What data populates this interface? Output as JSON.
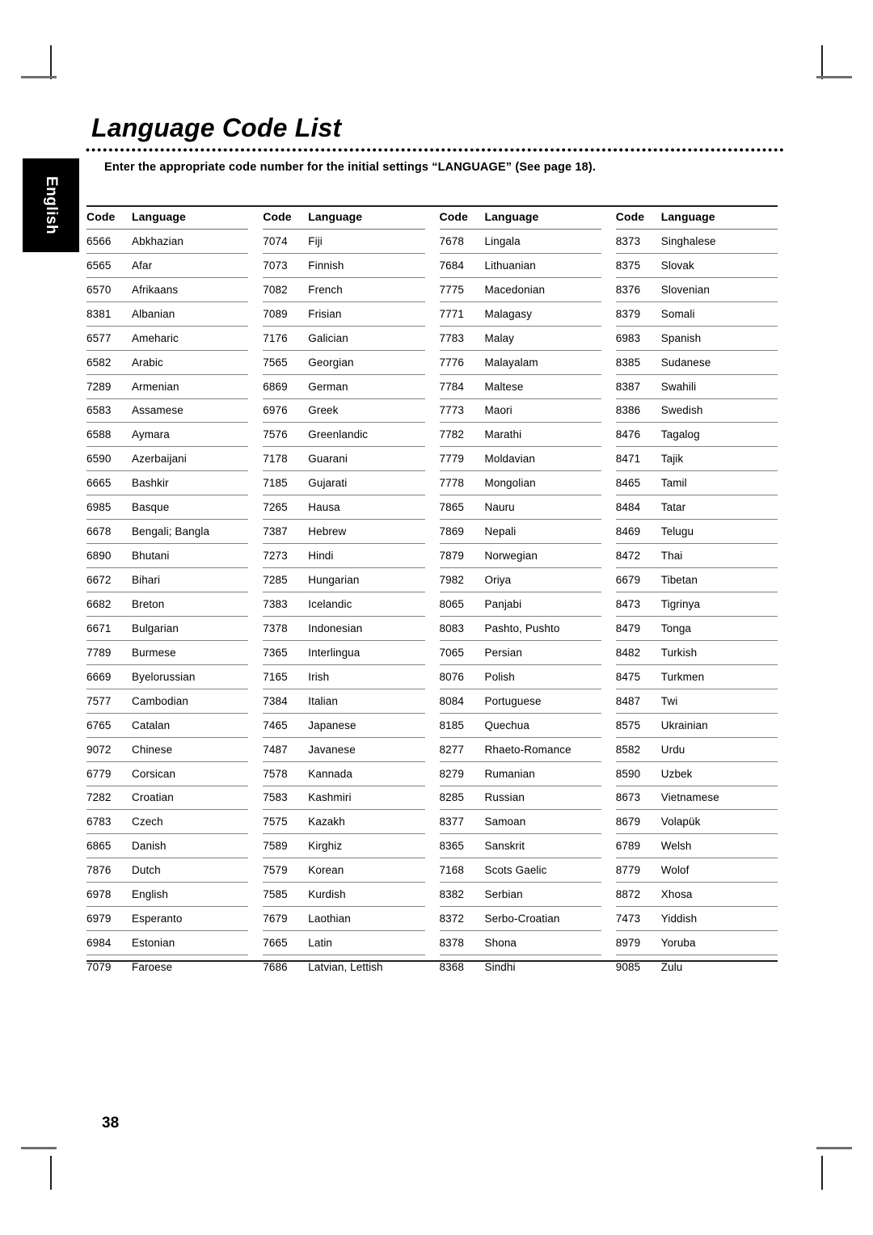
{
  "page": {
    "title": "Language Code List",
    "subtitle": "Enter the appropriate code number for the initial settings “LANGUAGE” (See page 18).",
    "side_tab_label": "English",
    "page_number": "38"
  },
  "table": {
    "headers": {
      "code": "Code",
      "language": "Language"
    },
    "columns": [
      {
        "rows": [
          {
            "code": "6566",
            "language": "Abkhazian"
          },
          {
            "code": "6565",
            "language": "Afar"
          },
          {
            "code": "6570",
            "language": "Afrikaans"
          },
          {
            "code": "8381",
            "language": "Albanian"
          },
          {
            "code": "6577",
            "language": "Ameharic"
          },
          {
            "code": "6582",
            "language": "Arabic"
          },
          {
            "code": "7289",
            "language": "Armenian"
          },
          {
            "code": "6583",
            "language": "Assamese"
          },
          {
            "code": "6588",
            "language": "Aymara"
          },
          {
            "code": "6590",
            "language": "Azerbaijani"
          },
          {
            "code": "6665",
            "language": "Bashkir"
          },
          {
            "code": "6985",
            "language": "Basque"
          },
          {
            "code": "6678",
            "language": "Bengali; Bangla"
          },
          {
            "code": "6890",
            "language": "Bhutani"
          },
          {
            "code": "6672",
            "language": "Bihari"
          },
          {
            "code": "6682",
            "language": "Breton"
          },
          {
            "code": "6671",
            "language": "Bulgarian"
          },
          {
            "code": "7789",
            "language": "Burmese"
          },
          {
            "code": "6669",
            "language": "Byelorussian"
          },
          {
            "code": "7577",
            "language": "Cambodian"
          },
          {
            "code": "6765",
            "language": "Catalan"
          },
          {
            "code": "9072",
            "language": "Chinese"
          },
          {
            "code": "6779",
            "language": "Corsican"
          },
          {
            "code": "7282",
            "language": "Croatian"
          },
          {
            "code": "6783",
            "language": "Czech"
          },
          {
            "code": "6865",
            "language": "Danish"
          },
          {
            "code": "7876",
            "language": "Dutch"
          },
          {
            "code": "6978",
            "language": "English"
          },
          {
            "code": "6979",
            "language": "Esperanto"
          },
          {
            "code": "6984",
            "language": "Estonian"
          },
          {
            "code": "7079",
            "language": "Faroese"
          }
        ]
      },
      {
        "rows": [
          {
            "code": "7074",
            "language": "Fiji"
          },
          {
            "code": "7073",
            "language": "Finnish"
          },
          {
            "code": "7082",
            "language": "French"
          },
          {
            "code": "7089",
            "language": "Frisian"
          },
          {
            "code": "7176",
            "language": "Galician"
          },
          {
            "code": "7565",
            "language": "Georgian"
          },
          {
            "code": "6869",
            "language": "German"
          },
          {
            "code": "6976",
            "language": "Greek"
          },
          {
            "code": "7576",
            "language": "Greenlandic"
          },
          {
            "code": "7178",
            "language": "Guarani"
          },
          {
            "code": "7185",
            "language": "Gujarati"
          },
          {
            "code": "7265",
            "language": "Hausa"
          },
          {
            "code": "7387",
            "language": "Hebrew"
          },
          {
            "code": "7273",
            "language": "Hindi"
          },
          {
            "code": "7285",
            "language": "Hungarian"
          },
          {
            "code": "7383",
            "language": "Icelandic"
          },
          {
            "code": "7378",
            "language": "Indonesian"
          },
          {
            "code": "7365",
            "language": "Interlingua"
          },
          {
            "code": "7165",
            "language": "Irish"
          },
          {
            "code": "7384",
            "language": "Italian"
          },
          {
            "code": "7465",
            "language": "Japanese"
          },
          {
            "code": "7487",
            "language": "Javanese"
          },
          {
            "code": "7578",
            "language": "Kannada"
          },
          {
            "code": "7583",
            "language": "Kashmiri"
          },
          {
            "code": "7575",
            "language": "Kazakh"
          },
          {
            "code": "7589",
            "language": "Kirghiz"
          },
          {
            "code": "7579",
            "language": "Korean"
          },
          {
            "code": "7585",
            "language": "Kurdish"
          },
          {
            "code": "7679",
            "language": "Laothian"
          },
          {
            "code": "7665",
            "language": "Latin"
          },
          {
            "code": "7686",
            "language": "Latvian, Lettish"
          }
        ]
      },
      {
        "rows": [
          {
            "code": "7678",
            "language": "Lingala"
          },
          {
            "code": "7684",
            "language": "Lithuanian"
          },
          {
            "code": "7775",
            "language": "Macedonian"
          },
          {
            "code": "7771",
            "language": "Malagasy"
          },
          {
            "code": "7783",
            "language": "Malay"
          },
          {
            "code": "7776",
            "language": "Malayalam"
          },
          {
            "code": "7784",
            "language": "Maltese"
          },
          {
            "code": "7773",
            "language": "Maori"
          },
          {
            "code": "7782",
            "language": "Marathi"
          },
          {
            "code": "7779",
            "language": "Moldavian"
          },
          {
            "code": "7778",
            "language": "Mongolian"
          },
          {
            "code": "7865",
            "language": "Nauru"
          },
          {
            "code": "7869",
            "language": "Nepali"
          },
          {
            "code": "7879",
            "language": "Norwegian"
          },
          {
            "code": "7982",
            "language": "Oriya"
          },
          {
            "code": "8065",
            "language": "Panjabi"
          },
          {
            "code": "8083",
            "language": "Pashto, Pushto"
          },
          {
            "code": "7065",
            "language": "Persian"
          },
          {
            "code": "8076",
            "language": "Polish"
          },
          {
            "code": "8084",
            "language": "Portuguese"
          },
          {
            "code": "8185",
            "language": "Quechua"
          },
          {
            "code": "8277",
            "language": "Rhaeto-Romance"
          },
          {
            "code": "8279",
            "language": "Rumanian"
          },
          {
            "code": "8285",
            "language": "Russian"
          },
          {
            "code": "8377",
            "language": "Samoan"
          },
          {
            "code": "8365",
            "language": "Sanskrit"
          },
          {
            "code": "7168",
            "language": "Scots Gaelic"
          },
          {
            "code": "8382",
            "language": "Serbian"
          },
          {
            "code": "8372",
            "language": "Serbo-Croatian"
          },
          {
            "code": "8378",
            "language": "Shona"
          },
          {
            "code": "8368",
            "language": "Sindhi"
          }
        ]
      },
      {
        "rows": [
          {
            "code": "8373",
            "language": "Singhalese"
          },
          {
            "code": "8375",
            "language": "Slovak"
          },
          {
            "code": "8376",
            "language": "Slovenian"
          },
          {
            "code": "8379",
            "language": "Somali"
          },
          {
            "code": "6983",
            "language": "Spanish"
          },
          {
            "code": "8385",
            "language": "Sudanese"
          },
          {
            "code": "8387",
            "language": "Swahili"
          },
          {
            "code": "8386",
            "language": "Swedish"
          },
          {
            "code": "8476",
            "language": "Tagalog"
          },
          {
            "code": "8471",
            "language": "Tajik"
          },
          {
            "code": "8465",
            "language": "Tamil"
          },
          {
            "code": "8484",
            "language": "Tatar"
          },
          {
            "code": "8469",
            "language": "Telugu"
          },
          {
            "code": "8472",
            "language": "Thai"
          },
          {
            "code": "6679",
            "language": "Tibetan"
          },
          {
            "code": "8473",
            "language": "Tigrinya"
          },
          {
            "code": "8479",
            "language": "Tonga"
          },
          {
            "code": "8482",
            "language": "Turkish"
          },
          {
            "code": "8475",
            "language": "Turkmen"
          },
          {
            "code": "8487",
            "language": "Twi"
          },
          {
            "code": "8575",
            "language": "Ukrainian"
          },
          {
            "code": "8582",
            "language": "Urdu"
          },
          {
            "code": "8590",
            "language": "Uzbek"
          },
          {
            "code": "8673",
            "language": "Vietnamese"
          },
          {
            "code": "8679",
            "language": "Volapük"
          },
          {
            "code": "6789",
            "language": "Welsh"
          },
          {
            "code": "8779",
            "language": "Wolof"
          },
          {
            "code": "8872",
            "language": "Xhosa"
          },
          {
            "code": "7473",
            "language": "Yiddish"
          },
          {
            "code": "8979",
            "language": "Yoruba"
          },
          {
            "code": "9085",
            "language": "Zulu"
          }
        ]
      }
    ]
  }
}
